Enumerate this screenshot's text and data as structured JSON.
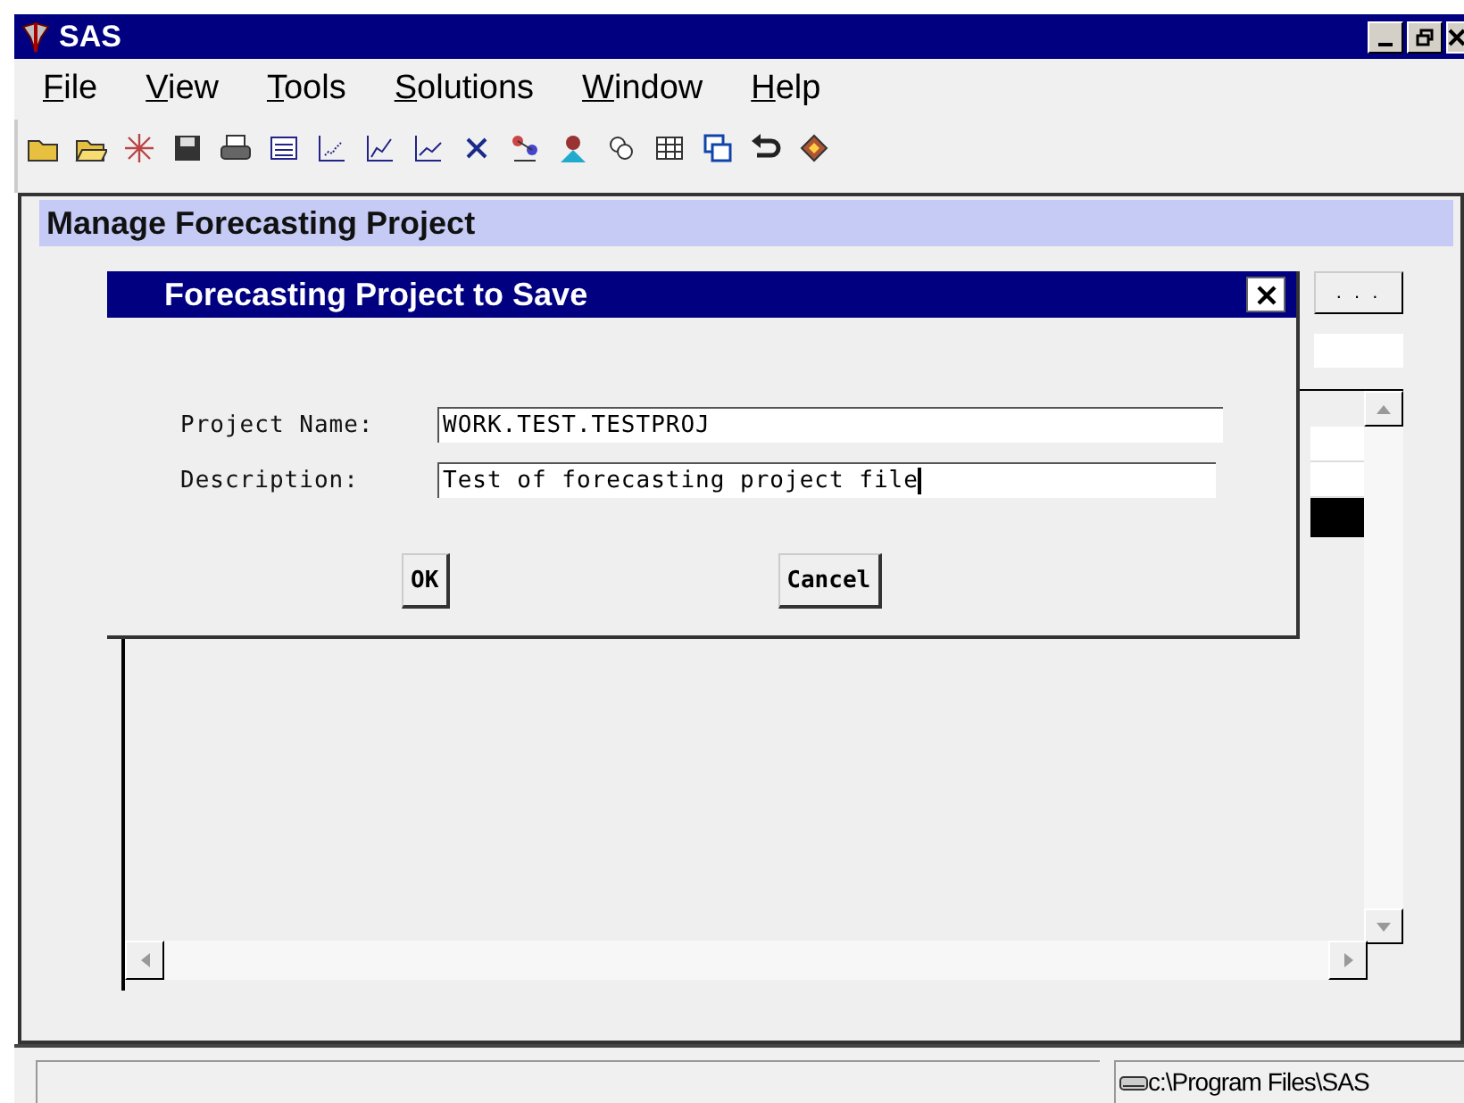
{
  "window": {
    "title": "SAS"
  },
  "menu": [
    {
      "label": "File"
    },
    {
      "label": "View"
    },
    {
      "label": "Tools"
    },
    {
      "label": "Solutions"
    },
    {
      "label": "Window"
    },
    {
      "label": "Help"
    }
  ],
  "panel": {
    "title": "Manage Forecasting Project",
    "browse_button": ". . .",
    "list_selected_row": true
  },
  "dialog": {
    "title": "Forecasting Project to Save",
    "fields": [
      {
        "label": "Project Name:",
        "value": "WORK.TEST.TESTPROJ"
      },
      {
        "label": "Description:",
        "value": "Test of forecasting project file"
      }
    ],
    "buttons": [
      "OK",
      "Cancel"
    ]
  },
  "status_bar": {
    "path": "c:\\Program Files\\SAS"
  }
}
